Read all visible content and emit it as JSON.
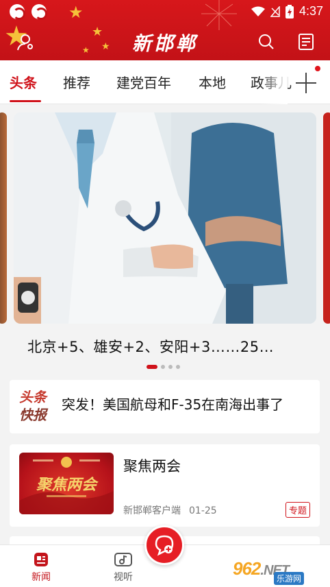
{
  "status_bar": {
    "time": "4:37"
  },
  "header": {
    "app_title": "新邯郸"
  },
  "tabs": [
    {
      "label": "头条",
      "active": true
    },
    {
      "label": "推荐",
      "active": false
    },
    {
      "label": "建党百年",
      "active": false
    },
    {
      "label": "本地",
      "active": false
    },
    {
      "label": "政事儿",
      "active": false
    }
  ],
  "banner": {
    "caption": "北京+5、雄安+2、安阳+3……25…",
    "page_count": 4,
    "current_page": 1
  },
  "flash": {
    "logo_line1": "头条",
    "logo_line2": "快报",
    "headline": "突发！美国航母和F-35在南海出事了"
  },
  "feature": {
    "title": "聚焦两会",
    "image_text": "聚焦两会",
    "source": "新邯郸客户端",
    "date": "01-25",
    "badge": "专题"
  },
  "bottom_nav": {
    "items": [
      {
        "label": "新闻",
        "active": true
      },
      {
        "label": "视听",
        "active": false
      }
    ]
  },
  "watermark": {
    "logo": "962",
    "suffix": ".NET",
    "sub": "乐游网"
  },
  "colors": {
    "brand_red": "#d0121a",
    "header_red": "#c31217",
    "star_gold": "#f5c23a"
  }
}
